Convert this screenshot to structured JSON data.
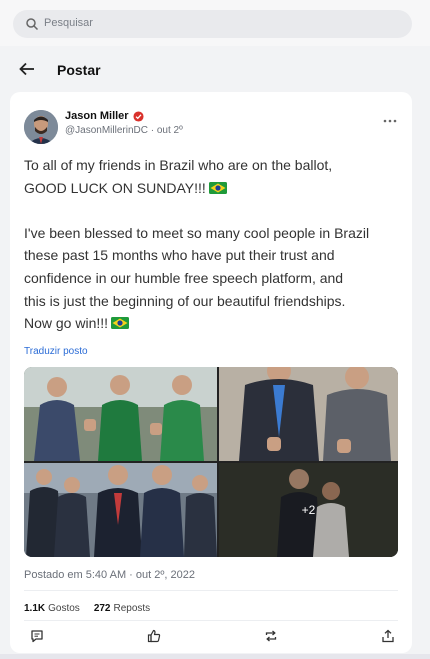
{
  "search": {
    "placeholder": "Pesquisar"
  },
  "header": {
    "title": "Postar"
  },
  "post": {
    "author_name": "Jason Miller",
    "author_handle": "@JasonMillerinDC",
    "separator": "·",
    "date_short": "out 2º",
    "paragraph1_lines": [
      "To all of my friends in Brazil who are on the ballot,",
      "GOOD LUCK ON SUNDAY!!!"
    ],
    "paragraph2_lines": [
      "I've been blessed to meet so many cool people in Brazil",
      "these past 15 months who have put their trust and",
      "confidence in our humble free speech platform, and",
      "this is just the beginning of our beautiful friendships.",
      "Now go win!!!"
    ],
    "translate_label": "Traduzir posto",
    "more_photos_label": "+2",
    "timestamp": "Postado em 5:40 AM · out 2º, 2022",
    "likes_count": "1.1K",
    "likes_label": "Gostos",
    "reposts_count": "272",
    "reposts_label": "Reposts"
  },
  "icons": {
    "search": "search-icon",
    "back": "arrow-left-icon",
    "verified": "verified-badge-icon",
    "more": "more-horizontal-icon",
    "flag": "brazil-flag-icon",
    "comment": "comment-icon",
    "like": "thumbs-up-icon",
    "repost": "repost-icon",
    "share": "share-icon"
  },
  "colors": {
    "link": "#2b6cd6",
    "verified": "#d9312b",
    "card": "#ffffff",
    "background": "#f2f3f5"
  }
}
